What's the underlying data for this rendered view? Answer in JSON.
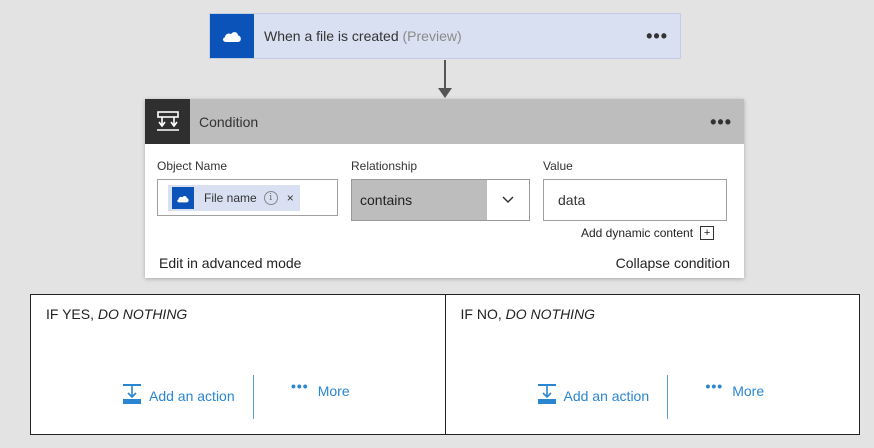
{
  "trigger": {
    "title": "When a file is created",
    "preview": "(Preview)",
    "menu_dots": "•••",
    "icon": "onedrive-cloud-icon"
  },
  "condition": {
    "title": "Condition",
    "menu_dots": "•••",
    "icon": "condition-icon",
    "object_name_label": "Object Name",
    "object_token": {
      "label": "File name",
      "info": "i",
      "remove": "×",
      "icon": "onedrive-cloud-icon"
    },
    "relationship_label": "Relationship",
    "relationship_value": "contains",
    "value_label": "Value",
    "value_value": "data",
    "add_dynamic_content": "Add dynamic content",
    "plus": "+",
    "edit_advanced": "Edit in advanced mode",
    "collapse": "Collapse condition"
  },
  "branches": {
    "yes": {
      "title_prefix": "IF YES, ",
      "title_italic": "DO NOTHING",
      "add_action": "Add an action",
      "more_dots": "•••",
      "more": "More"
    },
    "no": {
      "title_prefix": "IF NO, ",
      "title_italic": "DO NOTHING",
      "add_action": "Add an action",
      "more_dots": "•••",
      "more": "More"
    }
  },
  "colors": {
    "trigger_bg": "#d8e0f2",
    "brand_blue": "#0b53b8",
    "condition_header": "#bdbdbd",
    "link_blue": "#2a86d1"
  }
}
